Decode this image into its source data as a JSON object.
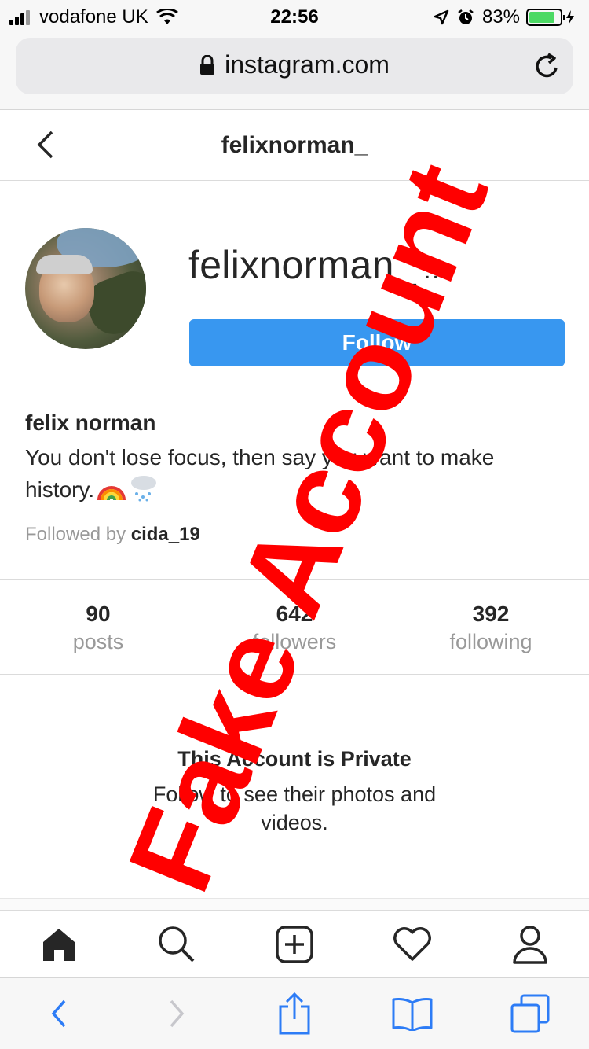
{
  "status_bar": {
    "carrier": "vodafone UK",
    "time": "22:56",
    "battery_percent": "83%",
    "battery_level": 0.83,
    "icons": [
      "signal-icon",
      "wifi-icon",
      "location-icon",
      "alarm-icon",
      "battery-icon",
      "charging-icon"
    ]
  },
  "browser": {
    "url": "instagram.com",
    "icons": [
      "lock-icon",
      "reload-icon"
    ]
  },
  "header": {
    "title": "felixnorman_",
    "back_icon": "chevron-left-icon"
  },
  "profile": {
    "username": "felixnorman_",
    "more": "...",
    "follow_label": "Follow",
    "full_name": "felix norman",
    "bio": "You don't lose focus, then say you want to make history.",
    "bio_emojis": [
      "rainbow-icon",
      "cloud-snow-icon"
    ],
    "followed_by_prefix": "Followed by",
    "followed_by_user": "cida_19"
  },
  "stats": [
    {
      "value": "90",
      "label": "posts"
    },
    {
      "value": "642",
      "label": "followers"
    },
    {
      "value": "392",
      "label": "following"
    }
  ],
  "private": {
    "title": "This Account is Private",
    "text": "Follow to see their photos and videos."
  },
  "ig_nav": [
    "home-icon",
    "search-icon",
    "new-post-icon",
    "activity-heart-icon",
    "profile-icon"
  ],
  "safari_toolbar": [
    "back-icon",
    "forward-icon",
    "share-icon",
    "bookmarks-icon",
    "tabs-icon"
  ],
  "overlay": {
    "text": "Fake Account",
    "color": "#ff0000"
  }
}
